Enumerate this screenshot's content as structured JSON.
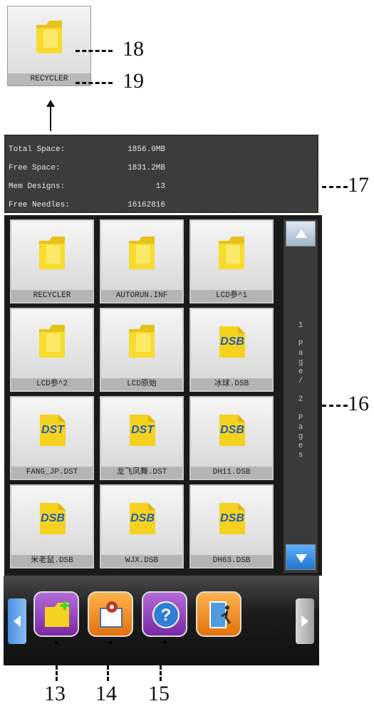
{
  "preview_tile": {
    "label": "RECYCLER",
    "icon": "folder-icon"
  },
  "callouts": {
    "n13": "13",
    "n14": "14",
    "n15": "15",
    "n16": "16",
    "n17": "17",
    "n18": "18",
    "n19": "19"
  },
  "info": {
    "rows": [
      {
        "label": "Total Space:",
        "value": "1856.0MB"
      },
      {
        "label": "Free Space:",
        "value": "1831.2MB"
      },
      {
        "label": "Mem Designs:",
        "value": "13"
      },
      {
        "label": "Free Needles:",
        "value": "16162816"
      }
    ]
  },
  "files": [
    {
      "name": "RECYCLER",
      "icon": "folder-icon"
    },
    {
      "name": "AUTORUN.INF",
      "icon": "folder-icon"
    },
    {
      "name": "LCD参^1",
      "icon": "folder-icon"
    },
    {
      "name": "LCD参^2",
      "icon": "folder-icon"
    },
    {
      "name": "LCD原始",
      "icon": "folder-icon"
    },
    {
      "name": "冰球.DSB",
      "icon": "dsb-file-icon",
      "type": "DSB"
    },
    {
      "name": "FANG_JP.DST",
      "icon": "dst-file-icon",
      "type": "DST"
    },
    {
      "name": "龙飞凤舞.DST",
      "icon": "dst-file-icon",
      "type": "DST"
    },
    {
      "name": "DH11.DSB",
      "icon": "dsb-file-icon",
      "type": "DSB"
    },
    {
      "name": "米老鼠.DSB",
      "icon": "dsb-file-icon",
      "type": "DSB"
    },
    {
      "name": "WJX.DSB",
      "icon": "dsb-file-icon",
      "type": "DSB"
    },
    {
      "name": "DH63.DSB",
      "icon": "dsb-file-icon",
      "type": "DSB"
    }
  ],
  "pagination": {
    "text": "1 Page/ 2 Pages"
  },
  "toolbar": {
    "buttons": [
      {
        "name": "new-folder-button",
        "icon": "new-folder-icon",
        "color": "#8e3bb5"
      },
      {
        "name": "pattern-settings-button",
        "icon": "pattern-gear-icon",
        "color": "#f08a1c"
      },
      {
        "name": "help-button",
        "icon": "question-icon",
        "color": "#8e3bb5"
      },
      {
        "name": "exit-button",
        "icon": "exit-door-icon",
        "color": "#f08a1c"
      }
    ]
  },
  "colors": {
    "scroll_button": "#2d8be6",
    "nav_arrow": "#6aa8e8"
  }
}
